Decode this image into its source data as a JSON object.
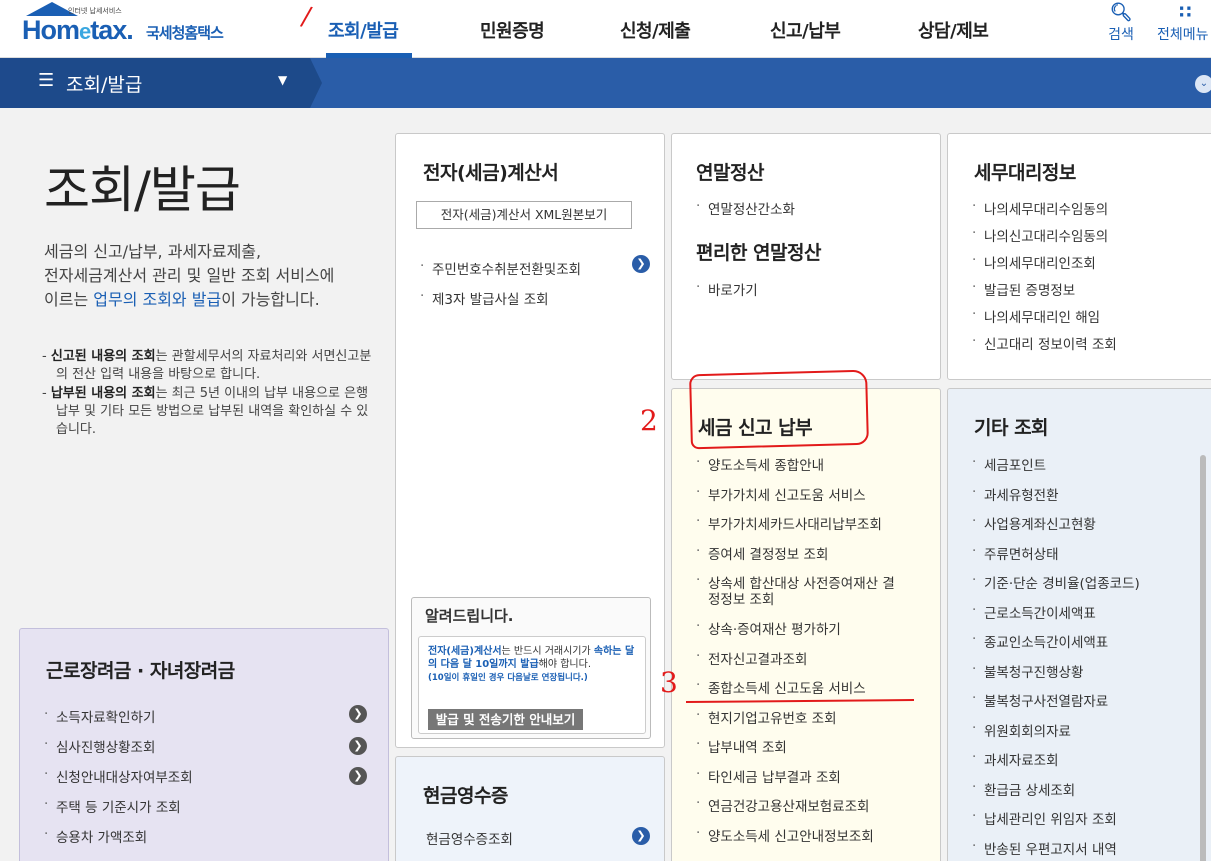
{
  "header": {
    "logo_small": "인터넷 납세서비스",
    "logo_hom": "Hom",
    "logo_e": "e",
    "logo_tax": "tax.",
    "logo_ko": "국세청홈택스",
    "nav": [
      "조회/발급",
      "민원증명",
      "신청/제출",
      "신고/납부",
      "상담/제보"
    ],
    "search_label": "검색",
    "allmenu_label": "전체메뉴"
  },
  "subnav": {
    "label": "조회/발급"
  },
  "intro": {
    "title": "조회/발급",
    "desc_1": "세금의 신고/납부, 과세자료제출,",
    "desc_2": "전자세금계산서 관리 및 일반 조회 서비스에",
    "desc_3a": "이르는 ",
    "desc_3b": "업무의 조회와 발급",
    "desc_3c": "이 가능합니다.",
    "note1_bold": "신고된 내용의 조회",
    "note1_rest": "는 관할세무서의 자료처리와 서면신고분의 전산 입력 내용을 바탕으로 합니다.",
    "note2_bold": "납부된 내용의 조회",
    "note2_rest": "는 최근 5년 이내의 납부 내용으로 은행 납부 및 기타 모든 방법으로 납부된 내역을 확인하실 수 있습니다."
  },
  "etax": {
    "title": "전자(세금)계산서",
    "xml_button": "전자(세금)계산서 XML원본보기",
    "items": [
      "주민번호수취분전환및조회",
      "제3자 발급사실 조회"
    ]
  },
  "notice": {
    "title": "알려드립니다.",
    "line_a": "전자(세금)계산서",
    "line_b": "는 반드시 거래시기가",
    "line_c": "속하는 달의 다음 달 10일까지 발급",
    "line_d": "해야 합니다.",
    "line_e": "(10일이 휴일인 경우 다음날로 연장됩니다.)",
    "button": "발급 및 전송기한 안내보기"
  },
  "cash": {
    "title": "현금영수증",
    "items": [
      "현금영수증조회"
    ]
  },
  "yearend": {
    "title": "연말정산",
    "items": [
      "연말정산간소화"
    ],
    "title2": "편리한 연말정산",
    "items2": [
      "바로가기"
    ]
  },
  "taxpay": {
    "title": "세금 신고 납부",
    "items": [
      "양도소득세 종합안내",
      "부가가치세 신고도움 서비스",
      "부가가치세카드사대리납부조회",
      "증여세 결정정보 조회",
      "상속세 합산대상 사전증여재산 결",
      "정정보 조회",
      "상속·증여재산 평가하기",
      "전자신고결과조회",
      "종합소득세 신고도움 서비스",
      "현지기업고유번호 조회",
      "납부내역 조회",
      "타인세금 납부결과 조회",
      "연금건강고용산재보험료조회",
      "양도소득세 신고안내정보조회"
    ]
  },
  "agent": {
    "title": "세무대리정보",
    "items": [
      "나의세무대리수임동의",
      "나의신고대리수임동의",
      "나의세무대리인조회",
      "발급된 증명정보",
      "나의세무대리인 해임",
      "신고대리 정보이력 조회"
    ]
  },
  "other": {
    "title": "기타 조회",
    "items": [
      "세금포인트",
      "과세유형전환",
      "사업용계좌신고현황",
      "주류면허상태",
      "기준·단순 경비율(업종코드)",
      "근로소득간이세액표",
      "종교인소득간이세액표",
      "불복청구진행상황",
      "불복청구사전열람자료",
      "위원회회의자료",
      "과세자료조회",
      "환급금 상세조회",
      "납세관리인 위임자 조회",
      "반송된 우편고지서 내역"
    ]
  },
  "earned": {
    "title": "근로장려금 · 자녀장려금",
    "items": [
      "소득자료확인하기",
      "심사진행상황조회",
      "신청안내대상자여부조회",
      "주택 등 기준시가 조회",
      "승용차 가액조회"
    ]
  },
  "annotations": {
    "one": "/",
    "two": "2",
    "three": "3"
  },
  "colors": {
    "brand": "#1a5fb4",
    "subnav": "#2a5da8",
    "annotation": "#e21a1a"
  }
}
